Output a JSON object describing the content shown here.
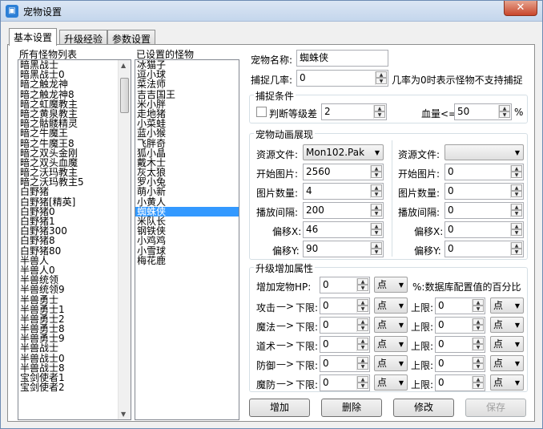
{
  "window": {
    "title": "宠物设置",
    "close": "✕"
  },
  "tabs": [
    "基本设置",
    "升级经验",
    "参数设置"
  ],
  "all_monsters": {
    "label": "所有怪物列表",
    "items": [
      "暗黑战士",
      "暗黑战士0",
      "暗之触龙神",
      "暗之触龙神8",
      "暗之虹魔教主",
      "暗之黄泉教主",
      "暗之骷髅精灵",
      "暗之牛魔王",
      "暗之牛魔王8",
      "暗之双头金刚",
      "暗之双头血魔",
      "暗之沃玛教主",
      "暗之沃玛教主5",
      "白野猪",
      "白野猪[精英]",
      "白野猪0",
      "白野猪1",
      "白野猪300",
      "白野猪8",
      "白野猪80",
      "半兽人",
      "半兽人0",
      "半兽统领",
      "半兽统领9",
      "半兽勇士",
      "半兽勇士1",
      "半兽勇士2",
      "半兽勇士8",
      "半兽勇士9",
      "半兽战士",
      "半兽战士0",
      "半兽战士8",
      "宝剑使者1",
      "宝剑使者2"
    ]
  },
  "set_monsters": {
    "label": "已设置的怪物",
    "items": [
      "冰猫子",
      "逗小球",
      "菜法师",
      "吉吉国王",
      "米小胖",
      "走地猪",
      "小菜蛙",
      "蓝小猴",
      "飞胖奇",
      "狐小晶",
      "戴木士",
      "灰太狼",
      "罗小兔",
      "萌小新",
      "小黄人",
      "蜘蛛侠",
      "米队长",
      "钢铁侠",
      "小鸡鸡",
      "小雪球",
      "梅花鹿"
    ],
    "selected": "蜘蛛侠"
  },
  "pet": {
    "name_label": "宠物名称:",
    "name": "蜘蛛侠",
    "rate_label": "捕捉几率:",
    "rate": "0",
    "rate_note": "几率为0时表示怪物不支持捕捉"
  },
  "capture": {
    "title": "捕捉条件",
    "level_diff_label": "判断等级差",
    "level_diff": "2",
    "hp_label": "血量<=",
    "hp": "50",
    "hp_unit": "%"
  },
  "anim": {
    "title": "宠物动画展现",
    "left": {
      "res_label": "资源文件:",
      "res": "Mon102.Pak",
      "start_label": "开始图片:",
      "start": "2560",
      "count_label": "图片数量:",
      "count": "4",
      "interval_label": "播放间隔:",
      "interval": "200",
      "offx_label": "偏移X:",
      "offx": "46",
      "offy_label": "偏移Y:",
      "offy": "90"
    },
    "right": {
      "res_label": "资源文件:",
      "res": "",
      "start_label": "开始图片:",
      "start": "0",
      "count_label": "图片数量:",
      "count": "0",
      "interval_label": "播放间隔:",
      "interval": "0",
      "offx_label": "偏移X:",
      "offx": "0",
      "offy_label": "偏移Y:",
      "offy": "0"
    }
  },
  "upgrade": {
    "title": "升级增加属性",
    "hp_label": "增加宠物HP:",
    "hp": "0",
    "hp_unit": "点",
    "hp_note": "%:数据库配置值的百分比",
    "rows": [
      {
        "name": "攻击",
        "arrow": "—>",
        "low_label": "下限:",
        "low": "0",
        "low_unit": "点",
        "high_label": "上限:",
        "high": "0",
        "high_unit": "点"
      },
      {
        "name": "魔法",
        "arrow": "—>",
        "low_label": "下限:",
        "low": "0",
        "low_unit": "点",
        "high_label": "上限:",
        "high": "0",
        "high_unit": "点"
      },
      {
        "name": "道术",
        "arrow": "—>",
        "low_label": "下限:",
        "low": "0",
        "low_unit": "点",
        "high_label": "上限:",
        "high": "0",
        "high_unit": "点"
      },
      {
        "name": "防御",
        "arrow": "—>",
        "low_label": "下限:",
        "low": "0",
        "low_unit": "点",
        "high_label": "上限:",
        "high": "0",
        "high_unit": "点"
      },
      {
        "name": "魔防",
        "arrow": "—>",
        "low_label": "下限:",
        "low": "0",
        "low_unit": "点",
        "high_label": "上限:",
        "high": "0",
        "high_unit": "点"
      }
    ]
  },
  "buttons": {
    "add": "增加",
    "delete": "删除",
    "modify": "修改",
    "save": "保存"
  }
}
